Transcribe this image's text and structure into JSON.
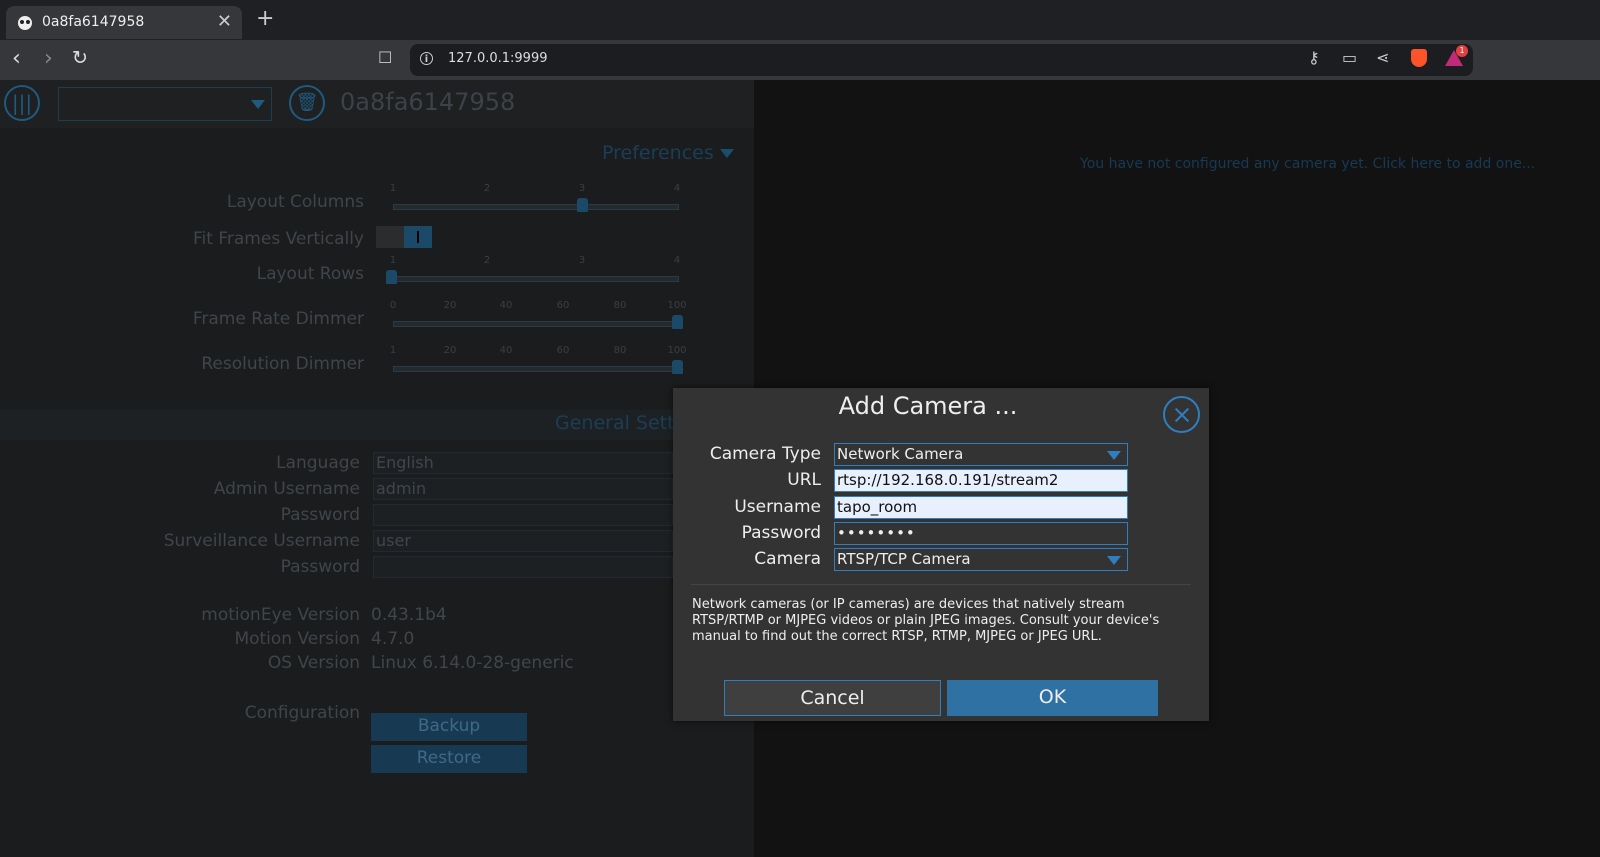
{
  "browser": {
    "tab_title": "0a8fa6147958",
    "new_tab": "+",
    "tab_close": "✕",
    "url": "127.0.0.1:9999",
    "rewards_count": "1"
  },
  "header": {
    "host_name": "0a8fa6147958"
  },
  "preferences": {
    "title": "Preferences",
    "layout_columns": {
      "label": "Layout Columns",
      "ticks": [
        "1",
        "2",
        "3",
        "4"
      ],
      "value": 3
    },
    "fit_frames": {
      "label": "Fit Frames Vertically",
      "value": true
    },
    "layout_rows": {
      "label": "Layout Rows",
      "ticks": [
        "1",
        "2",
        "3",
        "4"
      ],
      "value": 1
    },
    "frame_rate_dimmer": {
      "label": "Frame Rate Dimmer",
      "ticks": [
        "0",
        "20",
        "40",
        "60",
        "80",
        "100"
      ],
      "value": 100
    },
    "resolution_dimmer": {
      "label": "Resolution Dimmer",
      "ticks": [
        "1",
        "20",
        "40",
        "60",
        "80",
        "100"
      ],
      "value": 100
    }
  },
  "general": {
    "title": "General Sett",
    "language_label": "Language",
    "language_value": "English",
    "admin_username_label": "Admin Username",
    "admin_username_value": "admin",
    "admin_password_label": "Password",
    "surveillance_username_label": "Surveillance Username",
    "surveillance_username_value": "user",
    "surveillance_password_label": "Password",
    "motioneye_version_label": "motionEye Version",
    "motioneye_version_value": "0.43.1b4",
    "motion_version_label": "Motion Version",
    "motion_version_value": "4.7.0",
    "os_version_label": "OS Version",
    "os_version_value": "Linux 6.14.0-28-generic",
    "configuration_label": "Configuration",
    "backup_button": "Backup",
    "restore_button": "Restore"
  },
  "main": {
    "no_camera_text": "You have not configured any camera yet. Click here to add one..."
  },
  "modal": {
    "title": "Add Camera ...",
    "camera_type_label": "Camera Type",
    "camera_type_value": "Network Camera",
    "url_label": "URL",
    "url_value": "rtsp://192.168.0.191/stream2",
    "username_label": "Username",
    "username_value": "tapo_room",
    "password_label": "Password",
    "password_value": "••••••••",
    "camera_label": "Camera",
    "camera_value": "RTSP/TCP Camera",
    "description": "Network cameras (or IP cameras) are devices that natively stream RTSP/RTMP or MJPEG videos or plain JPEG images. Consult your device's manual to find out the correct RTSP, RTMP, MJPEG or JPEG URL.",
    "cancel_button": "Cancel",
    "ok_button": "OK"
  },
  "colors": {
    "accent": "#2f7ec0",
    "ok_button": "#3071a4",
    "modal_bg": "#333333"
  }
}
